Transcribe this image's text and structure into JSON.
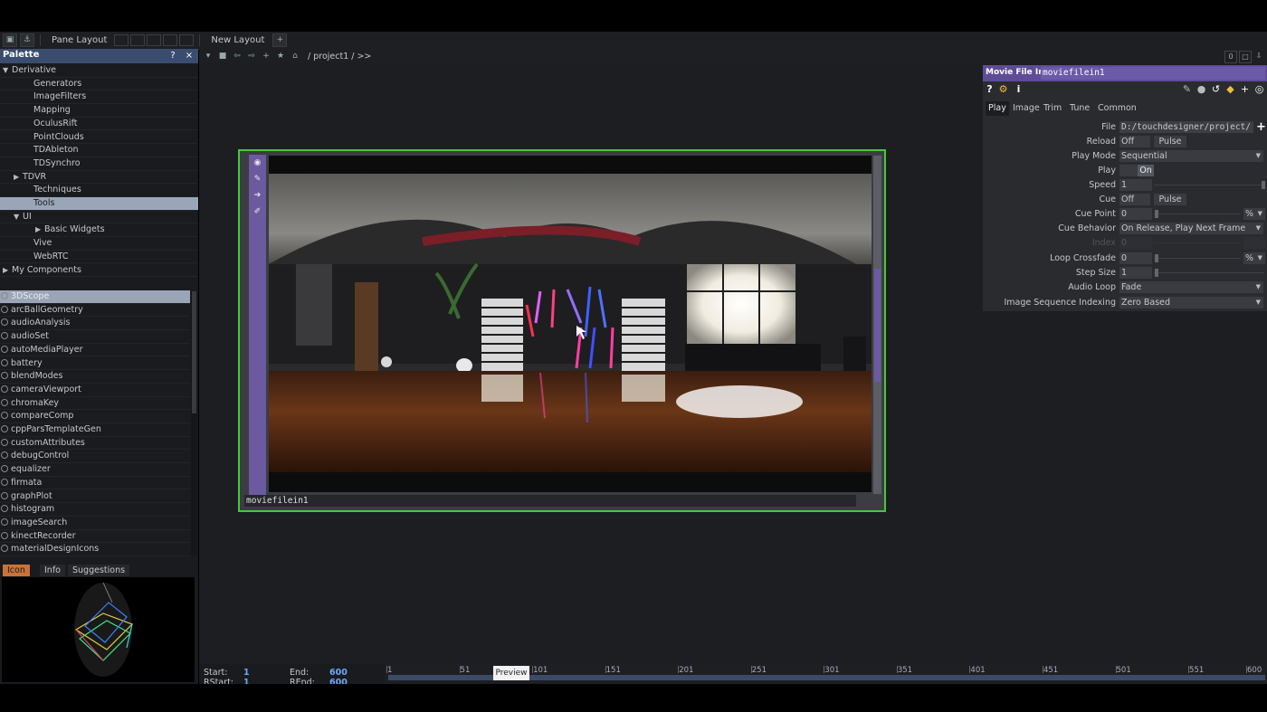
{
  "toolbar": {
    "pane_layout_label": "Pane Layout",
    "new_layout_label": "New Layout",
    "add_label": "+"
  },
  "palette": {
    "title": "Palette",
    "help": "?",
    "close": "×",
    "tree": [
      {
        "label": "Derivative",
        "indent": 0,
        "arrow": "▼"
      },
      {
        "label": "Generators",
        "indent": 2,
        "arrow": ""
      },
      {
        "label": "ImageFilters",
        "indent": 2,
        "arrow": ""
      },
      {
        "label": "Mapping",
        "indent": 2,
        "arrow": ""
      },
      {
        "label": "OculusRift",
        "indent": 2,
        "arrow": ""
      },
      {
        "label": "PointClouds",
        "indent": 2,
        "arrow": ""
      },
      {
        "label": "TDAbleton",
        "indent": 2,
        "arrow": ""
      },
      {
        "label": "TDSynchro",
        "indent": 2,
        "arrow": ""
      },
      {
        "label": "TDVR",
        "indent": 1,
        "arrow": "▶"
      },
      {
        "label": "Techniques",
        "indent": 2,
        "arrow": ""
      },
      {
        "label": "Tools",
        "indent": 2,
        "arrow": "",
        "selected": true
      },
      {
        "label": "UI",
        "indent": 1,
        "arrow": "▼"
      },
      {
        "label": "Basic Widgets",
        "indent": 3,
        "arrow": "▶"
      },
      {
        "label": "Vive",
        "indent": 2,
        "arrow": ""
      },
      {
        "label": "WebRTC",
        "indent": 2,
        "arrow": ""
      },
      {
        "label": "My Components",
        "indent": 0,
        "arrow": "▶"
      }
    ],
    "components": [
      "3DScope",
      "arcBallGeometry",
      "audioAnalysis",
      "audioSet",
      "autoMediaPlayer",
      "battery",
      "blendModes",
      "cameraViewport",
      "chromaKey",
      "compareComp",
      "cppParsTemplateGen",
      "customAttributes",
      "debugControl",
      "equalizer",
      "firmata",
      "graphPlot",
      "histogram",
      "imageSearch",
      "kinectRecorder",
      "materialDesignIcons"
    ],
    "info_tabs": [
      "Icon",
      "Info",
      "Suggestions"
    ]
  },
  "network": {
    "path": "/ project1 / >>",
    "right_count": "0",
    "node_name": "moviefilein1"
  },
  "params": {
    "op_type": "Movie File In",
    "op_name": "moviefilein1",
    "tabs": [
      "Play",
      "Image",
      "Trim",
      "Tune",
      "Common"
    ],
    "file_label": "File",
    "file_value": "D:/touchdesigner/project/",
    "reload_label": "Reload",
    "reload_value": "Off",
    "pulse_label": "Pulse",
    "playmode_label": "Play Mode",
    "playmode_value": "Sequential",
    "play_label": "Play",
    "play_value": "On",
    "speed_label": "Speed",
    "speed_value": "1",
    "cue_label": "Cue",
    "cue_value": "Off",
    "cuepoint_label": "Cue Point",
    "cuepoint_value": "0",
    "percent": "%",
    "cuebehavior_label": "Cue Behavior",
    "cuebehavior_value": "On Release, Play Next Frame",
    "index_label": "Index",
    "index_value": "0",
    "loopcross_label": "Loop Crossfade",
    "loopcross_value": "0",
    "stepsize_label": "Step Size",
    "stepsize_value": "1",
    "audioloop_label": "Audio Loop",
    "audioloop_value": "Fade",
    "imgseq_label": "Image Sequence Indexing",
    "imgseq_value": "Zero Based"
  },
  "timeline": {
    "start_label": "Start:",
    "start_value": "1",
    "end_label": "End:",
    "end_value": "600",
    "rstart_label": "RStart:",
    "rstart_value": "1",
    "rend_label": "REnd:",
    "rend_value": "600",
    "ticks": [
      "1",
      "51",
      "101",
      "151",
      "201",
      "251",
      "301",
      "351",
      "401",
      "451",
      "501",
      "551",
      "600"
    ],
    "preview_label": "Preview"
  }
}
